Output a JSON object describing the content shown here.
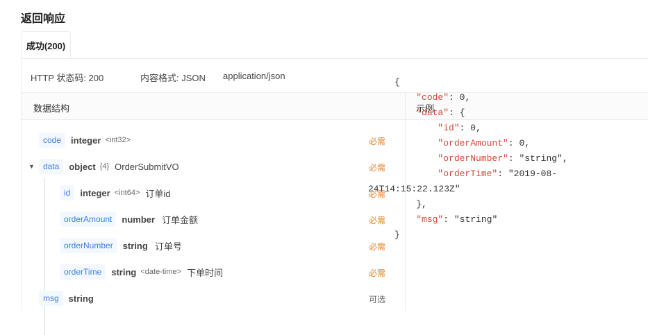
{
  "section": {
    "title": "返回响应"
  },
  "tab": {
    "label": "成功(200)"
  },
  "meta": {
    "status_code": "HTTP 状态码: 200",
    "content_format": "内容格式: JSON",
    "mime": "application/json"
  },
  "columns": {
    "schema": "数据结构",
    "example": "示例"
  },
  "fields": {
    "code": {
      "name": "code",
      "type": "integer",
      "format": "<int32>",
      "required": "必需"
    },
    "data": {
      "name": "data",
      "type": "object",
      "count": "{4}",
      "desc": "OrderSubmitVO",
      "required": "必需"
    },
    "id": {
      "name": "id",
      "type": "integer",
      "format": "<int64>",
      "desc": "订单id",
      "required": "必需"
    },
    "orderAmount": {
      "name": "orderAmount",
      "type": "number",
      "desc": "订单金额",
      "required": "必需"
    },
    "orderNumber": {
      "name": "orderNumber",
      "type": "string",
      "desc": "订单号",
      "required": "必需"
    },
    "orderTime": {
      "name": "orderTime",
      "type": "string",
      "format": "<date-time>",
      "desc": "下单时间",
      "required": "必需"
    },
    "msg": {
      "name": "msg",
      "type": "string",
      "required": "可选"
    }
  },
  "example": {
    "open": "{",
    "code_key": "\"code\"",
    "code_val": "0",
    "data_key": "\"data\"",
    "id_key": "\"id\"",
    "id_val": "0",
    "amount_key": "\"orderAmount\"",
    "amount_val": "0",
    "number_key": "\"orderNumber\"",
    "number_val": "\"string\"",
    "time_key": "\"orderTime\"",
    "time_val_1": "\"2019-08-",
    "time_val_2": "24T14:15:22.123Z\"",
    "data_close": "},",
    "msg_key": "\"msg\"",
    "msg_val": "\"string\"",
    "close": "}"
  },
  "icons": {
    "expand": "caret-down-icon"
  }
}
